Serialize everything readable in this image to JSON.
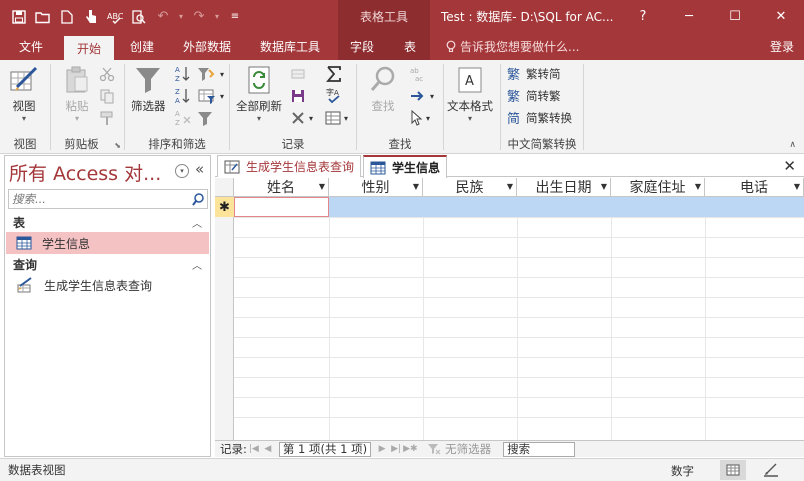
{
  "quick_access": {
    "items": [
      "save-icon",
      "open-icon",
      "new-icon",
      "touch-mode-icon",
      "spelling-icon",
      "print-preview-icon",
      "undo-icon",
      "redo-icon",
      "customize-icon"
    ]
  },
  "title_bar": {
    "context_label": "表格工具",
    "window_title": "Test : 数据库- D:\\SQL for AC...",
    "help": "?",
    "minimize": "─",
    "maximize": "☐",
    "close": "✕"
  },
  "tabs": [
    {
      "label": "文件"
    },
    {
      "label": "开始"
    },
    {
      "label": "创建"
    },
    {
      "label": "外部数据"
    },
    {
      "label": "数据库工具"
    },
    {
      "label": "字段"
    },
    {
      "label": "表"
    }
  ],
  "tell_me": "告诉我您想要做什么...",
  "login": "登录",
  "ribbon": {
    "groups": {
      "views": "视图",
      "clipboard": "剪贴板",
      "sort_filter": "排序和筛选",
      "records": "记录",
      "find": "查找",
      "chinese_conversion": "中文简繁转换"
    },
    "buttons": {
      "view": "视图",
      "paste": "粘贴",
      "filter": "筛选器",
      "refresh_all": "全部刷新",
      "find": "查找",
      "text_format": "文本格式",
      "trad_to_simp": "繁转简",
      "simp_to_trad": "简转繁",
      "simp_trad_convert": "简繁转换"
    }
  },
  "nav_pane": {
    "title": "所有 Access 对...",
    "search_placeholder": "搜索...",
    "sections": [
      {
        "label": "表",
        "items": [
          "学生信息"
        ]
      },
      {
        "label": "查询",
        "items": [
          "生成学生信息表查询"
        ]
      }
    ]
  },
  "doc_tabs": [
    {
      "label": "生成学生信息表查询",
      "active": false
    },
    {
      "label": "学生信息",
      "active": true
    }
  ],
  "grid": {
    "columns": [
      "姓名",
      "性别",
      "民族",
      "出生日期",
      "家庭住址",
      "电话"
    ],
    "new_record_marker": "✱"
  },
  "record_nav": {
    "label": "记录:",
    "position": "第 1 项(共 1 项)",
    "filter_label": "无筛选器",
    "search_label": "搜索"
  },
  "status_bar": {
    "left": "数据表视图",
    "numlock": "数字"
  },
  "colors": {
    "accent": "#a4373a",
    "selection": "#bcd7f3",
    "nav_selected": "#f5c2c4"
  }
}
